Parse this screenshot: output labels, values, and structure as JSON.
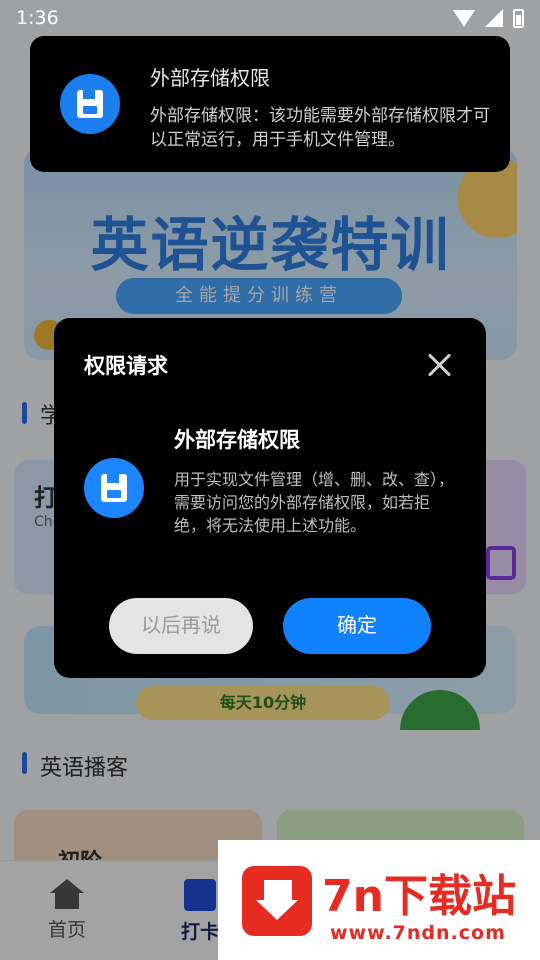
{
  "status_bar": {
    "time": "1:36"
  },
  "background": {
    "banner": {
      "title": "英语逆袭特训",
      "subtitle": "全能提分训练营"
    },
    "section_title_partial": "学",
    "card_left": {
      "title": "打",
      "subtitle": "Ch"
    },
    "promo": {
      "pill": "每天10分钟"
    },
    "podcast_section_title": "英语播客",
    "podcast_card_left": "初阶",
    "bottom_nav": [
      {
        "label": "首页",
        "icon": "home-icon"
      },
      {
        "label": "打卡",
        "icon": "checkin-icon"
      }
    ]
  },
  "toast": {
    "title": "外部存储权限",
    "description": "外部存储权限：该功能需要外部存储权限才可以正常运行，用于手机文件管理。",
    "icon": "save-icon"
  },
  "dialog": {
    "title": "权限请求",
    "permission_title": "外部存储权限",
    "permission_description": "用于实现文件管理（增、删、改、查），需要访问您的外部存储权限，如若拒绝，将无法使用上述功能。",
    "later_button": "以后再说",
    "confirm_button": "确定",
    "icon": "save-icon",
    "accent_color": "#1182ff"
  },
  "watermark": {
    "brand": "7n下载站",
    "url": "www.7ndn.com"
  }
}
